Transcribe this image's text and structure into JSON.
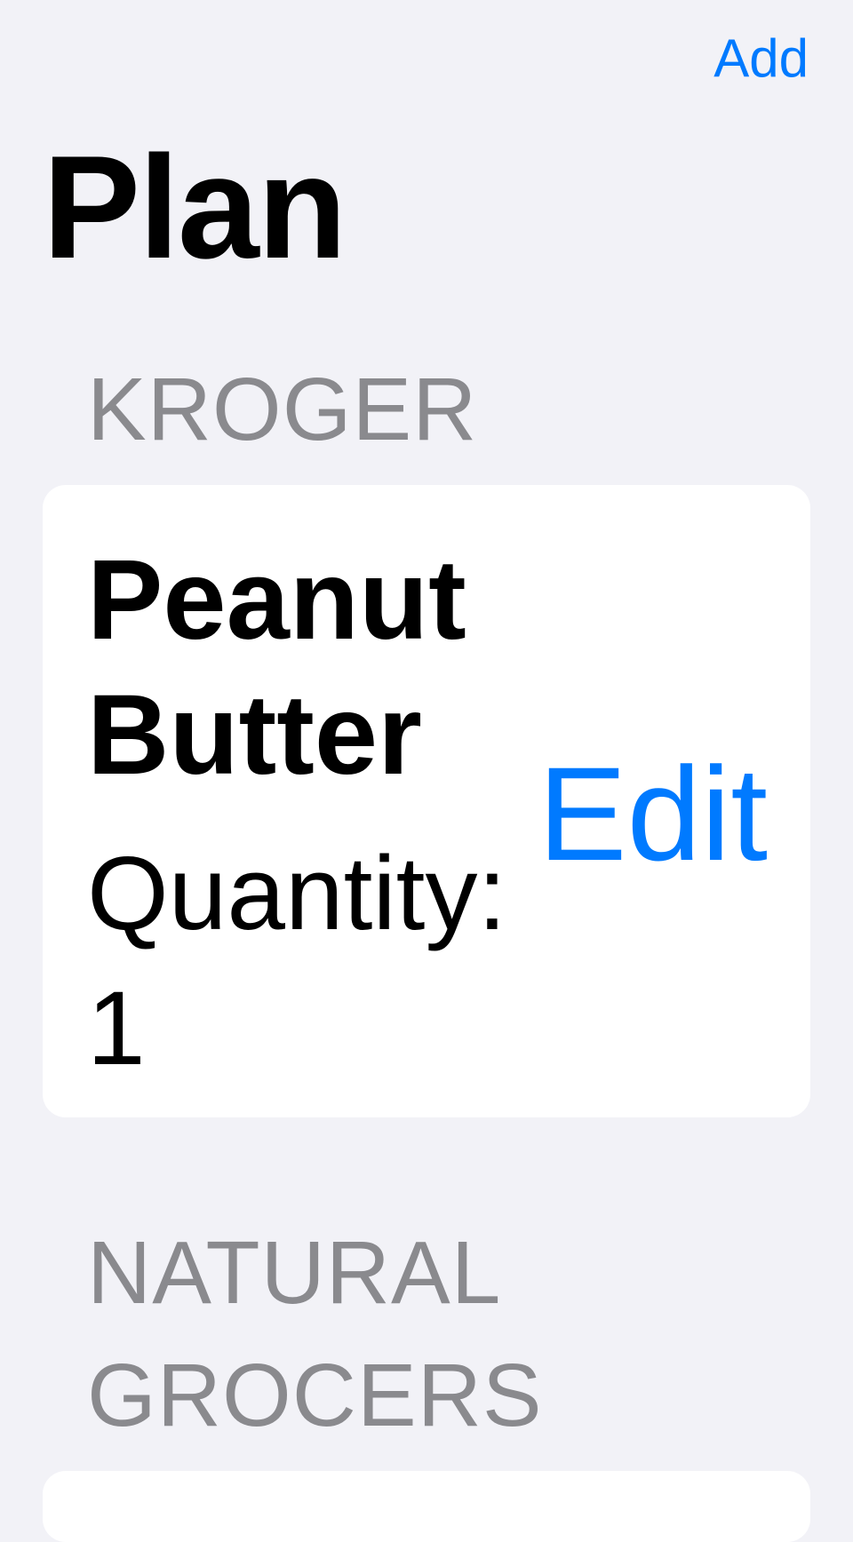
{
  "nav": {
    "add_label": "Add"
  },
  "page": {
    "title": "Plan"
  },
  "sections": [
    {
      "header": "KROGER",
      "items": [
        {
          "name": "Peanut Butter",
          "quantity": "Quantity: 1",
          "edit_label": "Edit"
        }
      ]
    },
    {
      "header": "NATURAL GROCERS",
      "items": []
    }
  ],
  "colors": {
    "background": "#F2F2F7",
    "card": "#FFFFFF",
    "accent": "#007AFF",
    "secondary_text": "#8A8A8E",
    "primary_text": "#000000"
  }
}
